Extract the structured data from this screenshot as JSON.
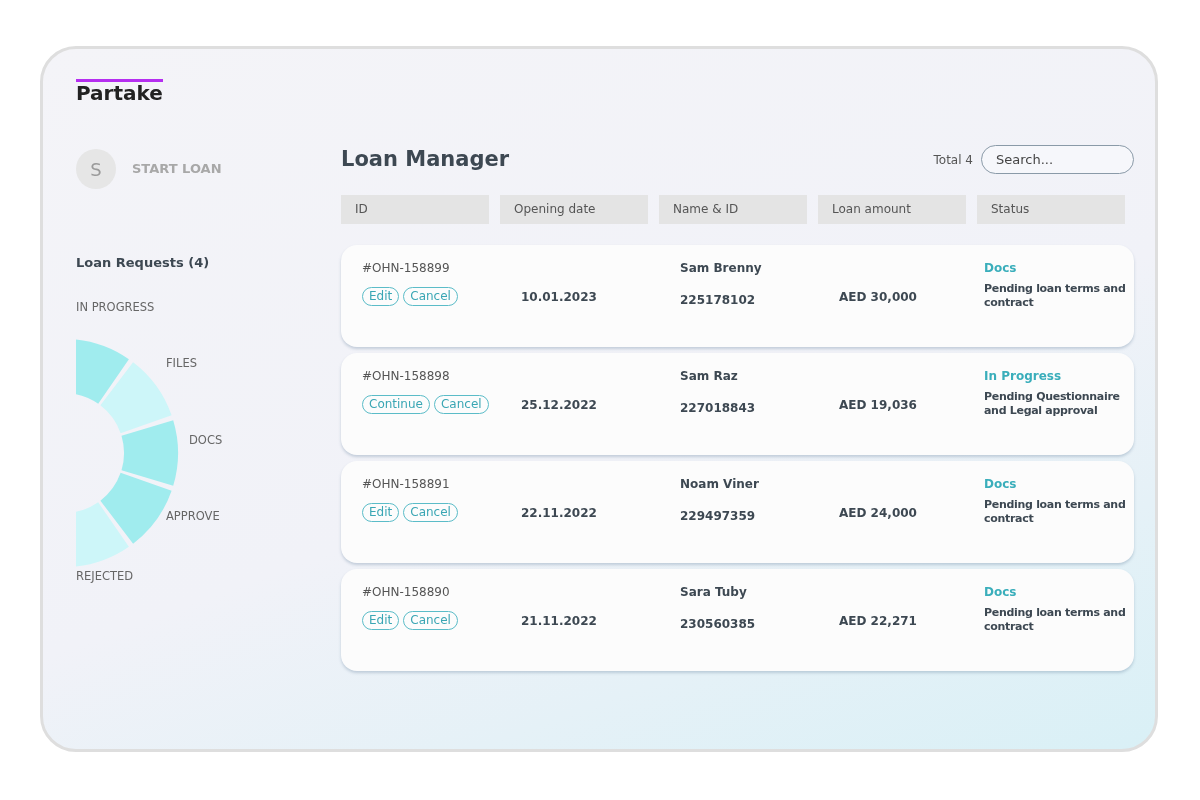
{
  "brand": {
    "name": "Partake"
  },
  "start_loan": {
    "avatar": "S",
    "label": "START LOAN"
  },
  "requests": {
    "title": "Loan Requests (4)",
    "segments": [
      {
        "label": "IN PROGRESS",
        "color": "#a0ecee"
      },
      {
        "label": "FILES",
        "color": "#cdf6f9"
      },
      {
        "label": "DOCS",
        "color": "#a0ecee"
      },
      {
        "label": "APPROVE",
        "color": "#a0ecee"
      },
      {
        "label": "REJECTED",
        "color": "#cdf6f9"
      }
    ]
  },
  "header": {
    "title": "Loan Manager",
    "total": "Total 4",
    "search": {
      "placeholder": "Search..."
    }
  },
  "table": {
    "columns": [
      "ID",
      "Opening date",
      "Name & ID",
      "Loan amount",
      "Status"
    ],
    "rows": [
      {
        "id": "#OHN-158899",
        "actions": [
          "Edit",
          "Cancel"
        ],
        "date": "10.01.2023",
        "name": "Sam Brenny",
        "national_id": "225178102",
        "amount": "AED 30,000",
        "status": "Docs",
        "status_note": "Pending loan terms and contract"
      },
      {
        "id": "#OHN-158898",
        "actions": [
          "Continue",
          "Cancel"
        ],
        "date": "25.12.2022",
        "name": "Sam Raz",
        "national_id": "227018843",
        "amount": "AED 19,036",
        "status": "In Progress",
        "status_note": "Pending Questionnaire and Legal approval"
      },
      {
        "id": "#OHN-158891",
        "actions": [
          "Edit",
          "Cancel"
        ],
        "date": "22.11.2022",
        "name": "Noam Viner",
        "national_id": "229497359",
        "amount": "AED 24,000",
        "status": "Docs",
        "status_note": "Pending loan terms and contract"
      },
      {
        "id": "#OHN-158890",
        "actions": [
          "Edit",
          "Cancel"
        ],
        "date": "21.11.2022",
        "name": "Sara Tuby",
        "national_id": "230560385",
        "amount": "AED 22,271",
        "status": "Docs",
        "status_note": "Pending loan terms and contract"
      }
    ]
  }
}
